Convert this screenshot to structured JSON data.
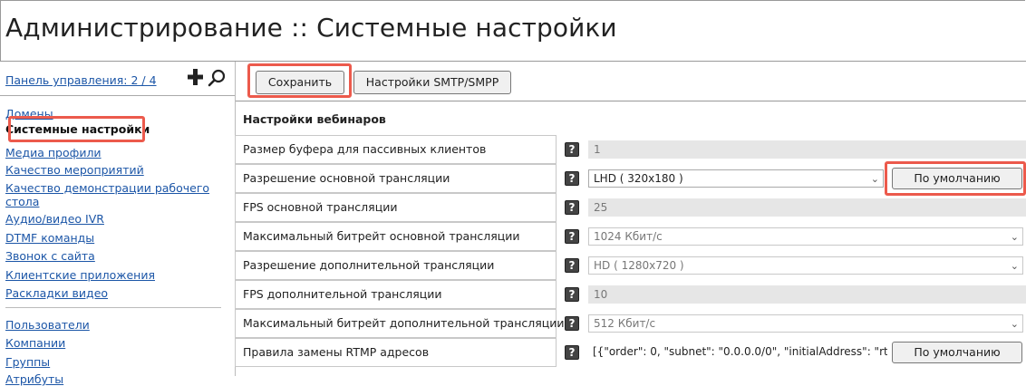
{
  "page": {
    "title": "Администрирование :: Системные настройки"
  },
  "sidebar": {
    "panel_link": "Панель управления: 2 / 4",
    "group1": [
      {
        "label": "Домены",
        "active": false
      },
      {
        "label": "Системные настройки",
        "active": true
      },
      {
        "label": "Медиа профили",
        "active": false
      },
      {
        "label": "Качество мероприятий",
        "active": false
      },
      {
        "label": "Качество демонстрации рабочего",
        "active": false
      },
      {
        "label": "стола",
        "active": false
      },
      {
        "label": "Аудио/видео IVR",
        "active": false
      },
      {
        "label": "DTMF команды",
        "active": false
      },
      {
        "label": "Звонок с сайта",
        "active": false
      },
      {
        "label": "Клиентские приложения",
        "active": false
      },
      {
        "label": "Раскладки видео",
        "active": false
      }
    ],
    "group2": [
      {
        "label": "Пользователи"
      },
      {
        "label": "Компании"
      },
      {
        "label": "Группы"
      },
      {
        "label": "Атрибуты"
      }
    ]
  },
  "toolbar": {
    "save_label": "Сохранить",
    "smtp_label": "Настройки SMTP/SMPP"
  },
  "section": {
    "title": "Настройки вебинаров"
  },
  "settings": [
    {
      "label": "Размер буфера для пассивных клиентов",
      "type": "readonly",
      "value": "1"
    },
    {
      "label": "Разрешение основной трансляции",
      "type": "select",
      "value": "LHD ( 320x180 )",
      "default_button": "По умолчанию"
    },
    {
      "label": "FPS основной трансляции",
      "type": "readonly",
      "value": "25"
    },
    {
      "label": "Максимальный битрейт основной трансляции",
      "type": "select",
      "value": "1024 Кбит/с"
    },
    {
      "label": "Разрешение дополнительной трансляции",
      "type": "select",
      "value": "HD ( 1280x720 )"
    },
    {
      "label": "FPS дополнительной трансляции",
      "type": "readonly",
      "value": "10"
    },
    {
      "label": "Максимальный битрейт дополнительной трансляции",
      "type": "select",
      "value": "512 Кбит/с"
    },
    {
      "label": "Правила замены RTMP адресов",
      "type": "text",
      "value": "[{\"order\": 0, \"subnet\": \"0.0.0.0/0\", \"initialAddress\": \"rtm...",
      "default_button": "По умолчанию"
    }
  ],
  "help_glyph": "?",
  "chevron_glyph": "⌄",
  "colors": {
    "link": "#1c56a7",
    "highlight": "#ec5a4c",
    "readonly_bg": "#e6e6e6"
  }
}
